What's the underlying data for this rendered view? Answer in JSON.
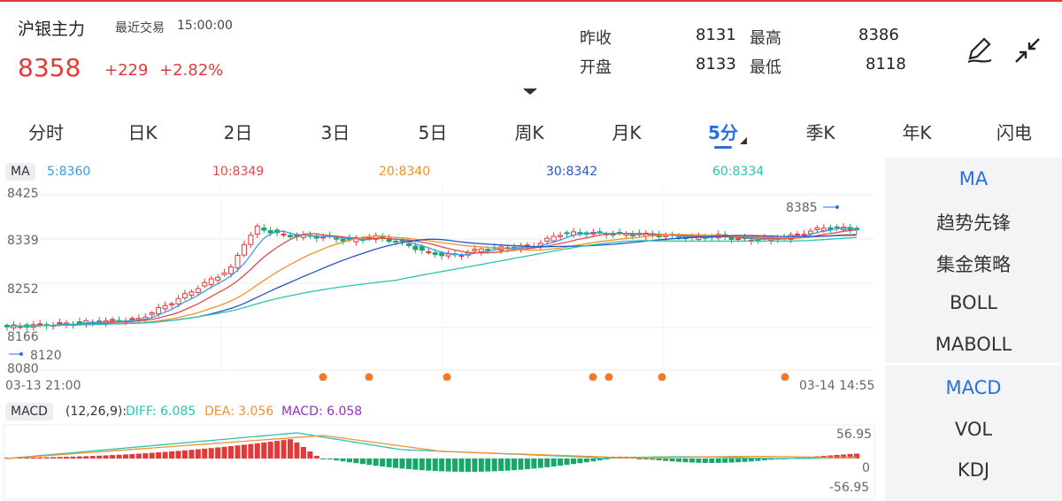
{
  "header": {
    "name": "沪银主力",
    "time_label": "最近交易",
    "time": "15:00:00",
    "price": "8358",
    "change": "+229",
    "change_pct": "+2.82%",
    "stats": [
      {
        "label": "昨收",
        "value": "8131"
      },
      {
        "label": "最高",
        "value": "8386"
      },
      {
        "label": "开盘",
        "value": "8133"
      },
      {
        "label": "最低",
        "value": "8118"
      }
    ]
  },
  "tabs": [
    "分时",
    "日K",
    "2日",
    "3日",
    "5日",
    "周K",
    "月K",
    "5分",
    "季K",
    "年K",
    "闪电"
  ],
  "active_tab": "5分",
  "ma": {
    "label": "MA",
    "items": [
      {
        "text": "5:8360",
        "color": "#3b9be8"
      },
      {
        "text": "10:8349",
        "color": "#e04b4b"
      },
      {
        "text": "20:8340",
        "color": "#f0922e"
      },
      {
        "text": "30:8342",
        "color": "#2555c8"
      },
      {
        "text": "60:8334",
        "color": "#2cc3b3"
      }
    ]
  },
  "price_axis": [
    "8425",
    "8339",
    "8252",
    "8166",
    "8080"
  ],
  "annotations": {
    "high": "8385",
    "low": "8120"
  },
  "time_axis": {
    "start": "03-13 21:00",
    "end": "03-14 14:55"
  },
  "macd": {
    "label": "MACD",
    "params": "(12,26,9):",
    "diff": "DIFF: 6.085",
    "dea": "DEA: 3.056",
    "macd": "MACD: 6.058",
    "axis": [
      "56.95",
      "0",
      "-56.95"
    ]
  },
  "sidebar": {
    "main": [
      "MA",
      "趋势先锋",
      "集金策略",
      "BOLL",
      "MABOLL"
    ],
    "sub": [
      "MACD",
      "VOL",
      "KDJ"
    ],
    "active_main": "MA",
    "active_sub": "MACD"
  },
  "colors": {
    "up": "#e03a3a",
    "down": "#16a869",
    "accent": "#2a6fdb"
  },
  "icons": [
    "draw-pen-icon",
    "collapse-icon",
    "chevron-down-icon",
    "triangle-icon"
  ]
}
